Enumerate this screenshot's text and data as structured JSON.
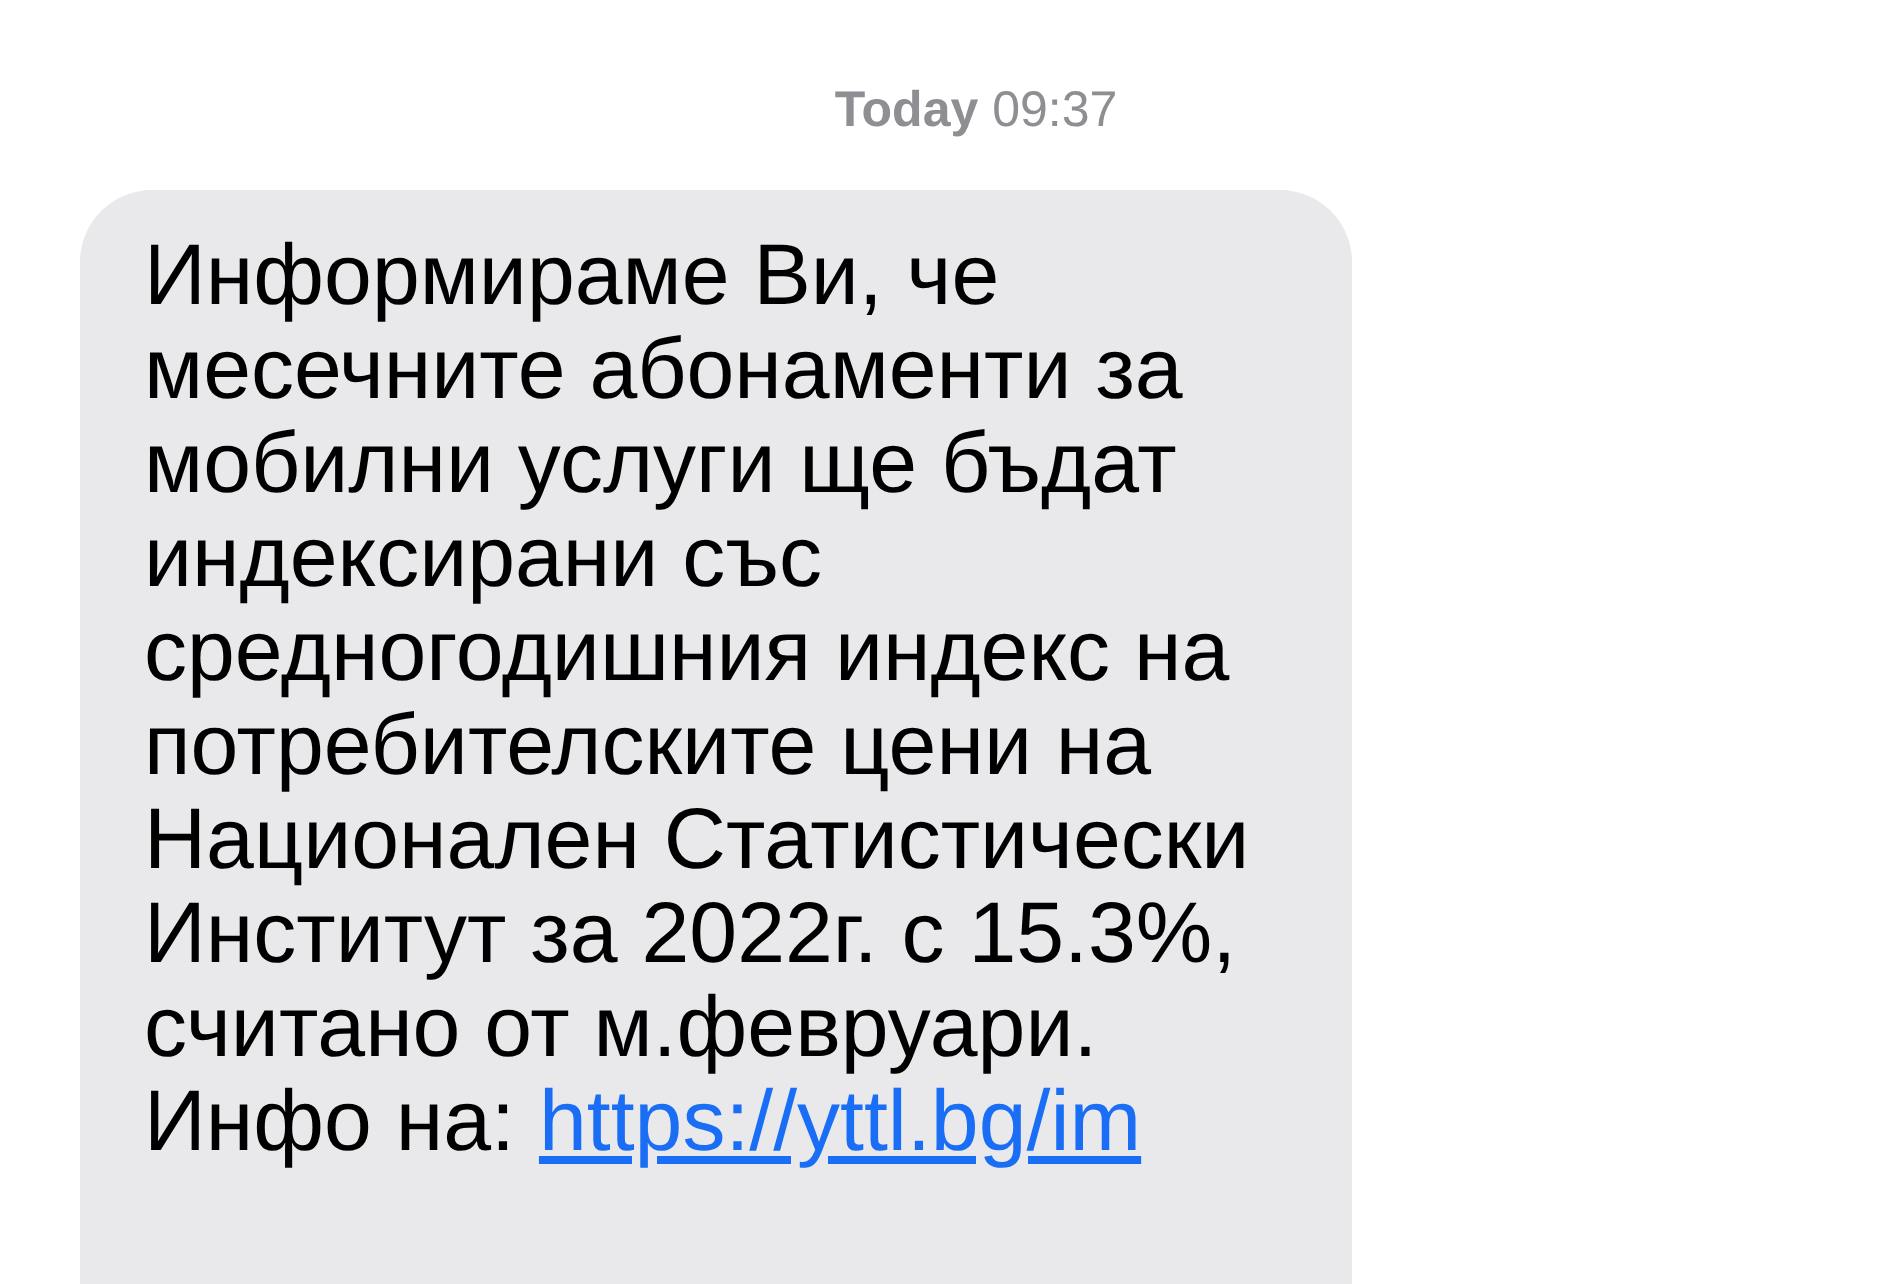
{
  "date_header": {
    "day": "Today",
    "time": "09:37"
  },
  "message": {
    "text": "Информираме Ви, че месечните абонаменти за мобилни услуги ще бъдат индексирани със средногодишния индекс на потребителските цени на Национален Статистически Институт за 2022г. с 15.3%, считано от м.февруари. Инфо на:",
    "link": "https://yttl.bg/im"
  }
}
